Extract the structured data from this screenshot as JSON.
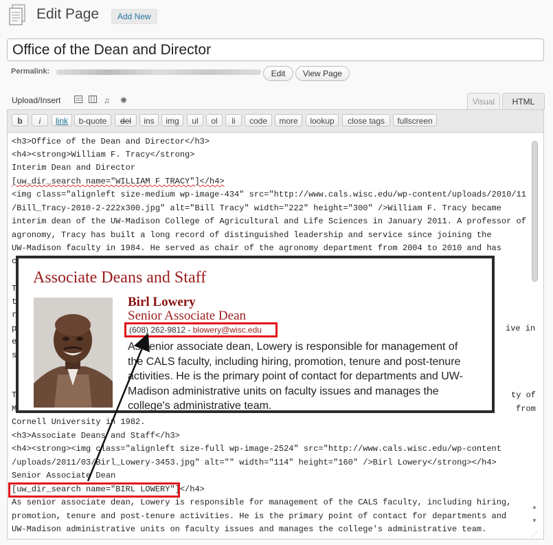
{
  "header": {
    "title": "Edit Page",
    "add_new": "Add New"
  },
  "post": {
    "title": "Office of the Dean and Director"
  },
  "permalink": {
    "label": "Permalink:",
    "edit_button": "Edit",
    "view_button": "View Page"
  },
  "media": {
    "label": "Upload/Insert",
    "icons": [
      "image-icon",
      "video-icon",
      "audio-icon",
      "media-icon"
    ]
  },
  "tabs": {
    "visual": "Visual",
    "html": "HTML"
  },
  "toolbar": {
    "buttons": [
      "b",
      "i",
      "link",
      "b-quote",
      "del",
      "ins",
      "img",
      "ul",
      "ol",
      "li",
      "code",
      "more",
      "lookup",
      "close tags",
      "fullscreen"
    ]
  },
  "editor": {
    "lines": [
      "<h3>Office of the Dean and Director</h3>",
      "<h4><strong>William F. Tracy</strong>",
      "Interim Dean and Director",
      "[uw_dir_search name=\"WILLIAM F TRACY\"]</h4>",
      "<img class=\"alignleft size-medium wp-image-434\" src=\"http://www.cals.wisc.edu/wp-content/uploads/2010/11",
      "/Bill_Tracy-2010-2-222x300.jpg\" alt=\"Bill Tracy\" width=\"222\" height=\"300\" />William F. Tracy became",
      "interim dean of the UW-Madison College of Agricultural and Life Sciences in January 2011. A professor of",
      "agronomy, Tracy has built a long record of distinguished leadership and service since joining the",
      "UW-Madison faculty in 1984. He served as chair of the agronomy department from 2004 to 2010 and has",
      "c",
      "",
      "T",
      "t",
      "r",
      "p",
      "e",
      "s",
      "",
      "T",
      "M",
      "Cornell University in 1982.",
      "<h3>Associate Deans and Staff</h3>",
      "<h4><strong><img class=\"alignleft size-full wp-image-2524\" src=\"http://www.cals.wisc.edu/wp-content",
      "/uploads/2011/03/Birl_Lowery-3453.jpg\" alt=\"\" width=\"114\" height=\"160\" />Birl Lowery</strong></h4>",
      "Senior Associate Dean",
      "[uw_dir_search name=\"BIRL LOWERY\"]</h4>",
      "As senior associate dean, Lowery is responsible for management of the CALS faculty, including hiring,",
      "promotion, tenure and post-tenure activities. He is the primary point of contact for departments and",
      "UW-Madison administrative units on faculty issues and manages the college's administrative team."
    ],
    "right_fragments": [
      "ive in",
      "ty of",
      "from"
    ]
  },
  "preview": {
    "heading": "Associate Deans and Staff",
    "name": "Birl Lowery",
    "role": "Senior Associate Dean",
    "phone": "(608) 262-9812 - ",
    "email": "blowery@wisc.edu",
    "bio": "As senior associate dean, Lowery is responsible for management of the CALS faculty, including hiring, promotion, tenure and post-tenure activities. He is the primary point of contact for departments and UW-Madison administrative units on faculty issues and manages the college's administrative team."
  },
  "colors": {
    "accent_red": "#e0141a",
    "heading_maroon": "#9b1c1c",
    "link_blue": "#21759b"
  }
}
